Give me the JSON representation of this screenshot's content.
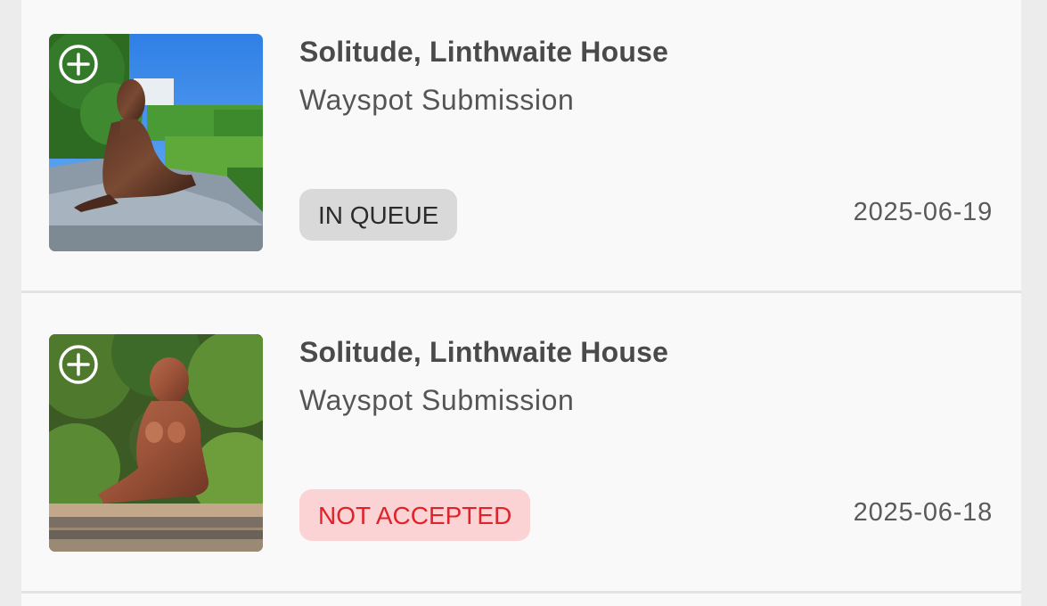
{
  "submissions": [
    {
      "title": "Solitude, Linthwaite House",
      "type": "Wayspot Submission",
      "status": "IN QUEUE",
      "status_color": "#d9d9d9",
      "date": "2025-06-19",
      "thumbnail_icon": "plus-circle-icon"
    },
    {
      "title": "Solitude, Linthwaite House",
      "type": "Wayspot Submission",
      "status": "NOT ACCEPTED",
      "status_color": "#fcd3d4",
      "date": "2025-06-18",
      "thumbnail_icon": "plus-circle-icon"
    }
  ]
}
